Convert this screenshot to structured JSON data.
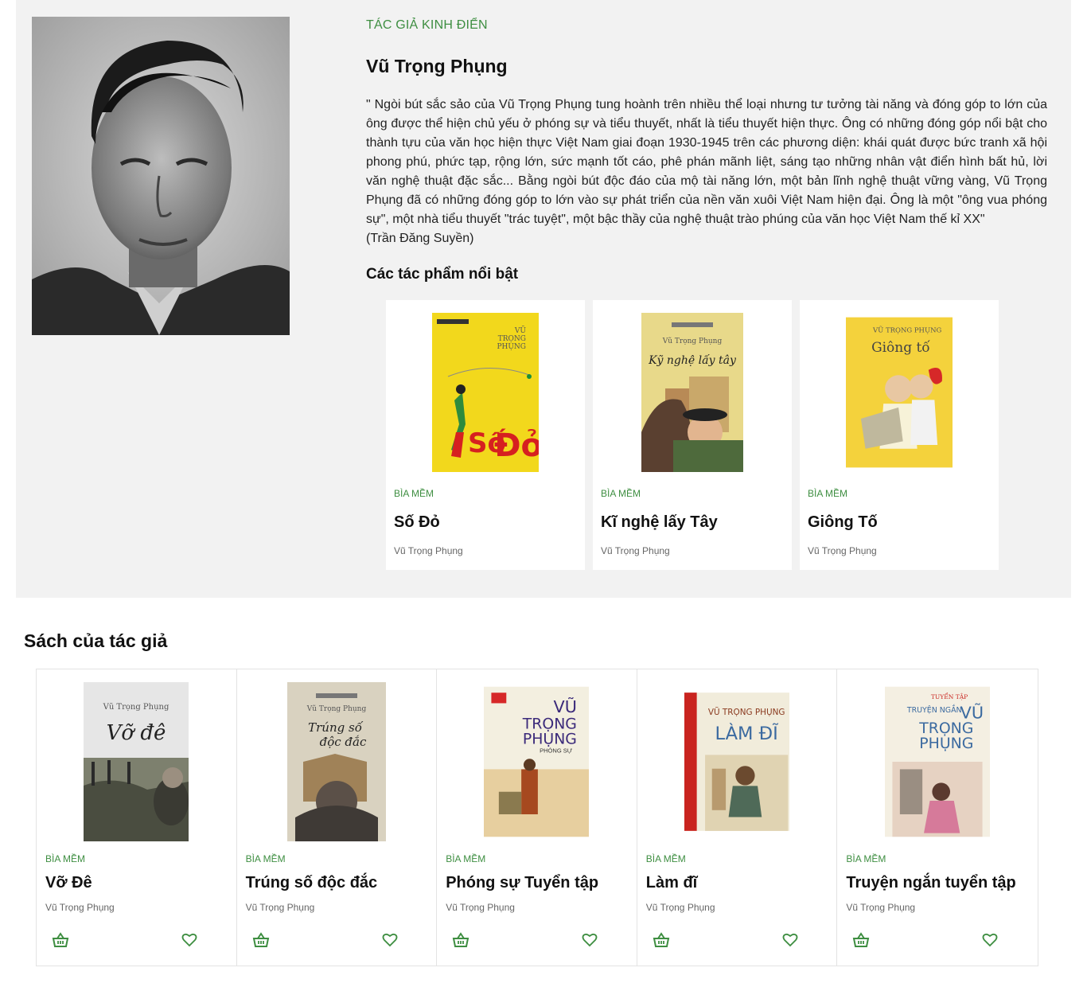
{
  "author": {
    "kicker": "TÁC GIẢ KINH ĐIỂN",
    "name": "Vũ Trọng Phụng",
    "bio_lines": [
      "\" Ngòi bút sắc sảo của Vũ Trọng Phụng tung hoành trên nhiều thể loại nhưng tư tưởng tài năng và đóng góp to lớn của ông được thể hiện chủ yếu ở phóng sự và tiểu thuyết, nhất là tiểu thuyết hiện thực. Ông có những đóng góp nổi bật cho thành tựu của văn học hiện thực Việt Nam giai đoạn 1930-1945 trên các phương diện: khái quát được bức tranh xã hội phong phú, phức tạp, rộng lớn, sức mạnh tốt cáo, phê phán mãnh liệt, sáng tạo những nhân vật điển hình bất hủ, lời văn nghệ thuật đặc sắc... Bằng ngòi bút độc đáo của mộ tài năng lớn, một bản lĩnh nghệ thuật vững vàng, Vũ Trọng Phụng đã có những đóng góp to lớn vào sự phát triển của nền văn xuôi Việt Nam hiện đại. Ông là một \"ông vua phóng sự\", một nhà tiểu thuyết \"trác tuyệt\", một bậc thầy của nghệ thuật trào phúng của văn học Việt Nam thế kỉ XX\"",
      "(Trần Đăng Suyền)"
    ]
  },
  "featured": {
    "heading": "Các tác phẩm nổi bật",
    "items": [
      {
        "format": "BÌA MỀM",
        "title": "Số Đỏ",
        "author": "Vũ Trọng Phụng",
        "cover_color": "#f2d81c",
        "cover_label": "Số Đỏ",
        "cover_author": "VŨ TRỌNG PHỤNG"
      },
      {
        "format": "BÌA MỀM",
        "title": "Kĩ nghệ lấy Tây",
        "author": "Vũ Trọng Phụng",
        "cover_color": "#e8d98a",
        "cover_label": "Kỹ nghệ lấy tây",
        "cover_author": "Vũ Trọng Phụng"
      },
      {
        "format": "BÌA MỀM",
        "title": "Giông Tố",
        "author": "Vũ Trọng Phụng",
        "cover_color": "#f4d23c",
        "cover_label": "Giông tố",
        "cover_author": "VŨ TRỌNG PHỤNG"
      }
    ]
  },
  "books": {
    "heading": "Sách của tác giả",
    "items": [
      {
        "format": "BÌA MỀM",
        "title": "Vỡ Đê",
        "author": "Vũ Trọng Phụng",
        "cover_color": "#e6e6e6",
        "cover_label": "Vỡ đê",
        "cover_author": "Vũ Trọng Phụng"
      },
      {
        "format": "BÌA MỀM",
        "title": "Trúng số độc đắc",
        "author": "Vũ Trọng Phụng",
        "cover_color": "#d9d2c0",
        "cover_label": "Trúng số độc đắc",
        "cover_author": "Vũ Trọng Phụng"
      },
      {
        "format": "BÌA MỀM",
        "title": "Phóng sự Tuyển tập",
        "author": "Vũ Trọng Phụng",
        "cover_color": "#f3efe0",
        "cover_label": "VŨ TRỌNG PHỤNG",
        "cover_author": "PHÓNG SỰ"
      },
      {
        "format": "BÌA MỀM",
        "title": "Làm đĩ",
        "author": "Vũ Trọng Phụng",
        "cover_color": "#f1ecdb",
        "cover_label": "LÀM ĐĨ",
        "cover_author": "VŨ TRỌNG PHỤNG"
      },
      {
        "format": "BÌA MỀM",
        "title": "Truyện ngắn tuyển tập",
        "author": "Vũ Trọng Phụng",
        "cover_color": "#f4efe2",
        "cover_label": "VŨ TRỌNG PHỤNG",
        "cover_author": "TUYỂN TẬP"
      }
    ]
  },
  "icons": {
    "cart": "cart-icon",
    "wishlist": "heart-icon"
  },
  "colors": {
    "accent": "#3e8e41",
    "section_bg": "#f2f2f2"
  }
}
